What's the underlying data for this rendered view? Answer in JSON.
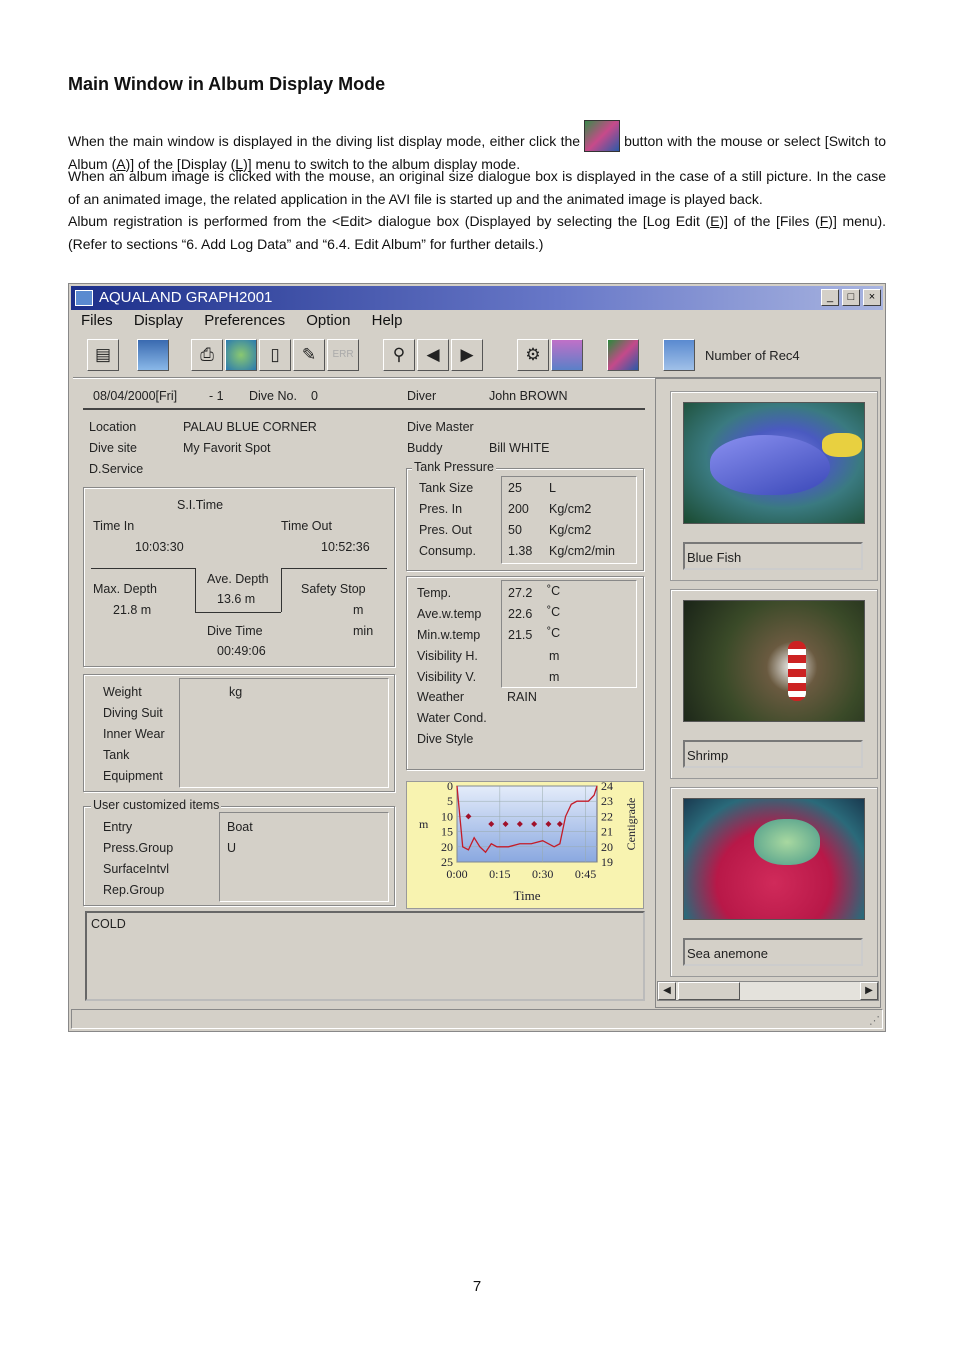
{
  "doc": {
    "title": "Main Window in Album Display Mode",
    "p1_before_icon": "When the main window is displayed in the diving list display mode, either click the",
    "p1_after_icon": "button with the mouse or select [Switch to Album (",
    "p1_key_a": "A",
    "p1_mid": ")] of the [Display (",
    "p1_key_l": "L",
    "p1_end": ")] menu to switch to the album display mode.",
    "p2": "When an album image is clicked with the mouse, an original size dialogue box is displayed in the case of a still picture. In the case of an animated image, the related application in the AVI file is started up and the animated image is played back.",
    "p3_a": "Album registration is performed from the <Edit> dialogue box (Displayed by selecting the [Log Edit (",
    "p3_key_e": "E",
    "p3_b": ")] of the [Files (",
    "p3_key_f": "F",
    "p3_c": ")] menu).  (Refer to sections “6. Add Log Data” and “6.4. Edit Album” for further details.)",
    "page_number": "7"
  },
  "window": {
    "title": "AQUALAND GRAPH2001",
    "controls": [
      "_",
      "□",
      "×"
    ],
    "menu": [
      "Files",
      "Display",
      "Preferences",
      "Option",
      "Help"
    ],
    "toolbar_disabled_label": "ERR",
    "toolbar_right_label": "Number of Rec4"
  },
  "log": {
    "date": "08/04/2000[Fri]",
    "seq": "- 1",
    "dive_no_label": "Dive No.",
    "dive_no": "0",
    "diver_label": "Diver",
    "diver": "John BROWN",
    "location_label": "Location",
    "location": "PALAU BLUE CORNER",
    "dive_site_label": "Dive site",
    "dive_site": "My Favorit Spot",
    "d_service_label": "D.Service",
    "dive_master_label": "Dive Master",
    "buddy_label": "Buddy",
    "buddy": "Bill WHITE",
    "si_time_label": "S.I.Time",
    "time_in_label": "Time In",
    "time_in": "10:03:30",
    "time_out_label": "Time Out",
    "time_out": "10:52:36",
    "max_depth_label": "Max. Depth",
    "max_depth": "21.8 m",
    "ave_depth_label": "Ave. Depth",
    "ave_depth": "13.6 m",
    "safety_stop_label": "Safety Stop",
    "safety_stop_unit_m": "m",
    "safety_stop_unit_min": "min",
    "dive_time_label": "Dive Time",
    "dive_time": "00:49:06",
    "tank_group_label": "Tank Pressure",
    "tank_size_label": "Tank Size",
    "tank_size": "25",
    "tank_size_unit": "L",
    "pres_in_label": "Pres. In",
    "pres_in": "200",
    "pres_in_unit": "Kg/cm2",
    "pres_out_label": "Pres. Out",
    "pres_out": "50",
    "pres_out_unit": "Kg/cm2",
    "consump_label": "Consump.",
    "consump": "1.38",
    "consump_unit": "Kg/cm2/min",
    "temp_label": "Temp.",
    "temp": "27.2",
    "ave_w_temp_label": "Ave.w.temp",
    "ave_w_temp": "22.6",
    "min_w_temp_label": "Min.w.temp",
    "min_w_temp": "21.5",
    "deg_unit": "˚C",
    "vis_h_label": "Visibility H.",
    "vis_v_label": "Visibility V.",
    "vis_unit": "m",
    "weather_label": "Weather",
    "weather": "RAIN",
    "water_cond_label": "Water Cond.",
    "dive_style_label": "Dive Style",
    "weight_label": "Weight",
    "weight_unit": "kg",
    "diving_suit_label": "Diving Suit",
    "inner_wear_label": "Inner Wear",
    "tank_label": "Tank",
    "equipment_label": "Equipment",
    "user_items_label": "User customized items",
    "entry_label": "Entry",
    "entry": "Boat",
    "press_group_label": "Press.Group",
    "press_group": "U",
    "surface_label": "SurfaceIntvl",
    "rep_group_label": "Rep.Group",
    "memo": "COLD"
  },
  "album": [
    {
      "caption": "Blue Fish"
    },
    {
      "caption": "Shrimp"
    },
    {
      "caption": "Sea anemone"
    }
  ],
  "chart_data": {
    "type": "line",
    "x_ticks": [
      "0:00",
      "0:15",
      "0:30",
      "0:45"
    ],
    "xlabel": "Time",
    "ylabel": "m",
    "y2label": "Centigrade",
    "y_ticks": [
      "0",
      "5",
      "10",
      "15",
      "20",
      "25"
    ],
    "y2_ticks": [
      "24",
      "23",
      "22",
      "21",
      "20",
      "19"
    ],
    "ylim": [
      0,
      25
    ],
    "y2lim": [
      19,
      24
    ],
    "xlim": [
      0,
      49
    ],
    "series": [
      {
        "values_x": [
          0,
          2,
          4,
          6,
          8,
          10,
          12,
          14,
          18,
          22,
          26,
          30,
          34,
          36,
          38,
          40,
          42,
          44,
          46,
          48,
          49
        ],
        "values_y": [
          0,
          20,
          21,
          17,
          20,
          21.8,
          19,
          20,
          20,
          19,
          19,
          18,
          20,
          19,
          10,
          6,
          5,
          5,
          5,
          3,
          0
        ],
        "color": "#c41c28"
      },
      {
        "values_x": [
          4,
          12,
          17,
          22,
          27,
          32,
          36
        ],
        "values_y": [
          22,
          21.5,
          21.5,
          21.5,
          21.5,
          21.5,
          21.5
        ],
        "color": "#a0102a"
      }
    ],
    "colors": {
      "background": "#f8f3b0",
      "plot": "#b8c8ee",
      "depth_line": "#c41c28"
    }
  }
}
